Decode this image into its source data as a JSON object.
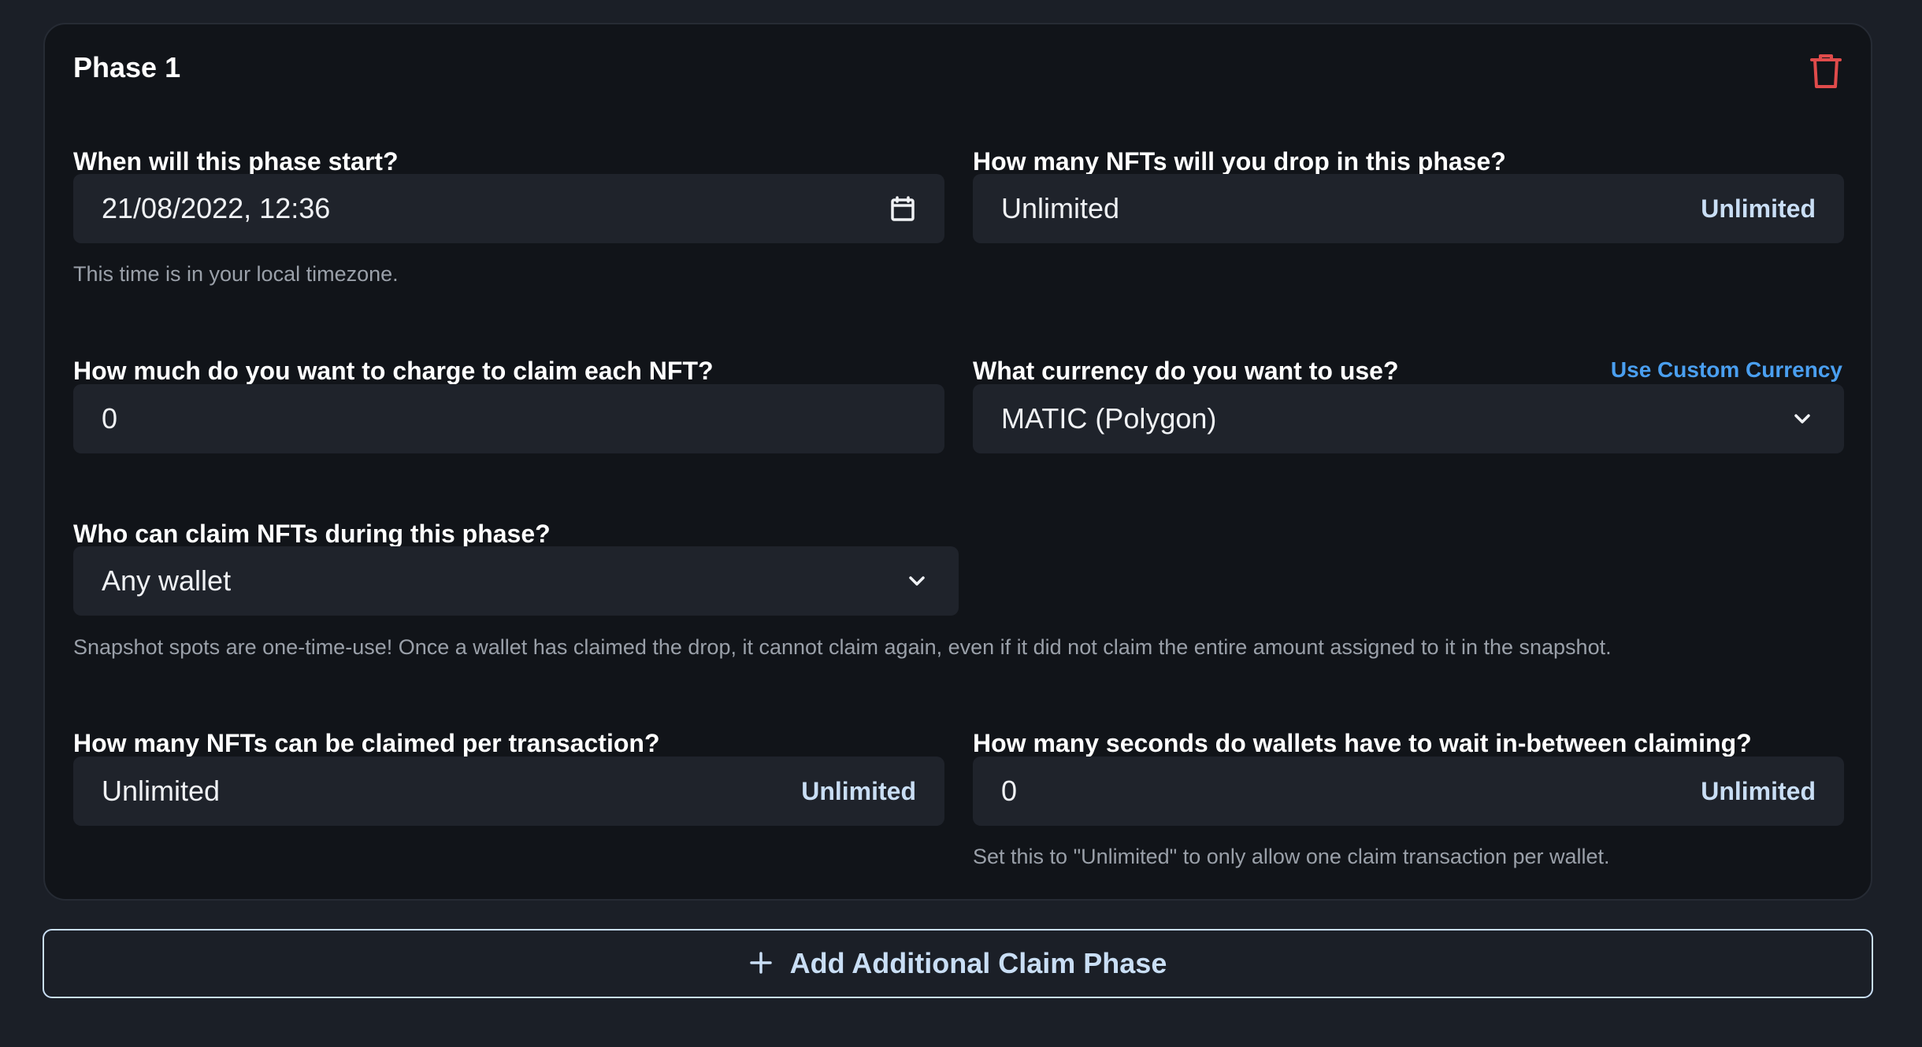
{
  "phase": {
    "title": "Phase 1",
    "delete_icon": "trash-icon"
  },
  "start": {
    "label": "When will this phase start?",
    "value": "21/08/2022, 12:36",
    "icon": "calendar-icon",
    "help": "This time is in your local timezone."
  },
  "max_supply": {
    "label": "How many NFTs will you drop in this phase?",
    "value": "Unlimited",
    "suffix": "Unlimited"
  },
  "price": {
    "label": "How much do you want to charge to claim each NFT?",
    "value": "0"
  },
  "currency": {
    "label": "What currency do you want to use?",
    "custom_link": "Use Custom Currency",
    "value": "MATIC (Polygon)",
    "icon": "chevron-down-icon"
  },
  "who": {
    "label": "Who can claim NFTs during this phase?",
    "value": "Any wallet",
    "icon": "chevron-down-icon",
    "help": "Snapshot spots are one-time-use! Once a wallet has claimed the drop, it cannot claim again, even if it did not claim the entire amount assigned to it in the snapshot."
  },
  "per_tx": {
    "label": "How many NFTs can be claimed per transaction?",
    "value": "Unlimited",
    "suffix": "Unlimited"
  },
  "wait": {
    "label": "How many seconds do wallets have to wait in-between claiming?",
    "value": "0",
    "suffix": "Unlimited",
    "help": "Set this to \"Unlimited\" to only allow one claim transaction per wallet."
  },
  "add_phase": {
    "icon": "plus-icon",
    "label": "Add Additional Claim Phase"
  },
  "colors": {
    "background": "#1b1f27",
    "card": "#111419",
    "input": "#1f232b",
    "accent_link": "#4a9ff0",
    "accent_light": "#c9def5",
    "danger": "#e04b4b"
  }
}
